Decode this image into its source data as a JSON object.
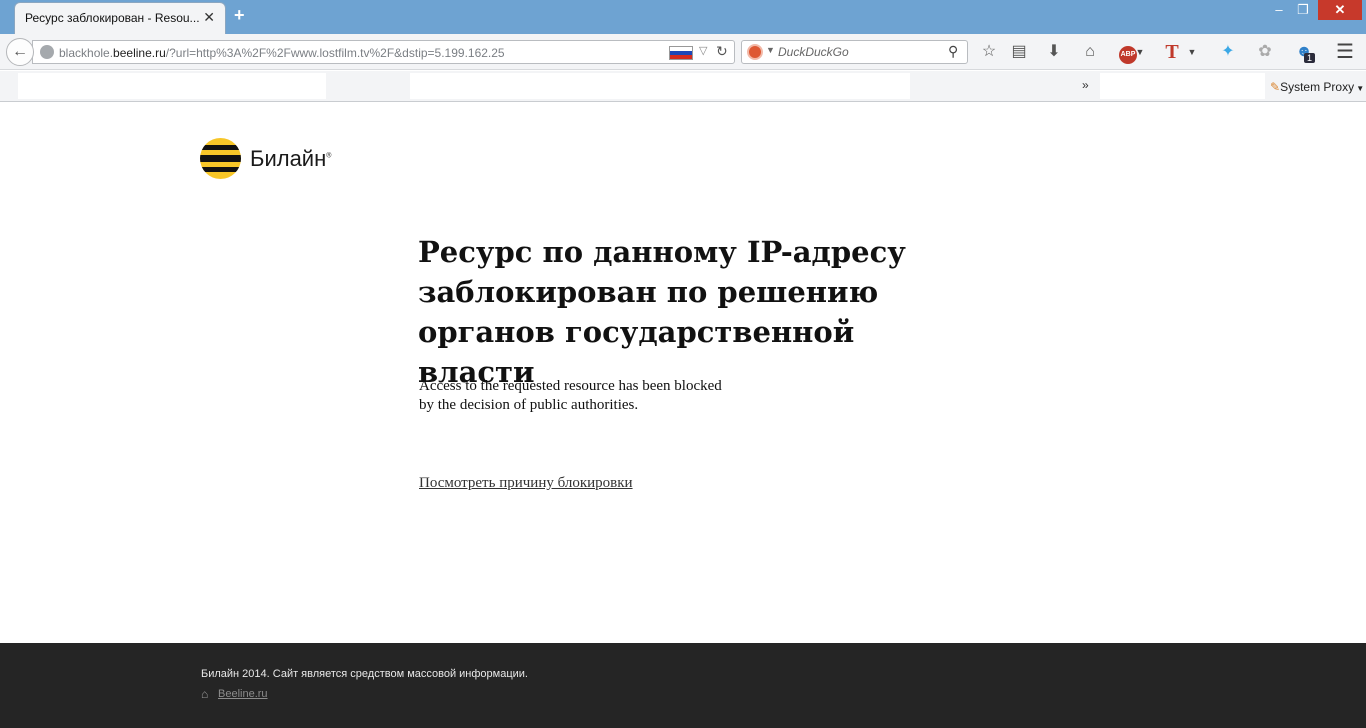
{
  "browser": {
    "tab_title": "Ресурс заблокирован - Resou...",
    "tab_close": "✕",
    "new_tab": "+",
    "window_controls": {
      "minimize": "‒",
      "restore": "❐",
      "close": "✕"
    }
  },
  "navbar": {
    "url_prefix": "blackhole.",
    "url_host": "beeline.ru",
    "url_rest": "/?url=http%3A%2F%2Fwww.lostfilm.tv%2F&dstip=5.199.162.25",
    "search_placeholder": "DuckDuckGo",
    "icons": [
      "back-icon",
      "globe-icon",
      "russia-flag-icon",
      "reload-icon",
      "duckduckgo-icon",
      "search-icon",
      "star-icon",
      "reader-icon",
      "download-icon",
      "home-icon",
      "adblock-icon",
      "t-icon",
      "twitter-icon",
      "paw-icon",
      "ghostery-icon",
      "menu-icon"
    ],
    "ghostery_badge": "1",
    "abp_label": "ABP"
  },
  "bookmarks": {
    "overflow": "»",
    "proxy_label": "System Proxy"
  },
  "page": {
    "logo_text": "Билайн",
    "logo_reg": "®",
    "headline": "Ресурс по данному IP-адресу заблокирован по решению органов государственной власти",
    "subtext_line1": "Access to the requested resource has been blocked",
    "subtext_line2": "by the decision of public authorities.",
    "reason_link": "Посмотреть причину блокировки"
  },
  "footer": {
    "text": "Билайн 2014. Сайт является средством массовой информации.",
    "link": "Beeline.ru"
  },
  "colors": {
    "titlebar": "#6ea3d2",
    "beeline_yellow": "#f7c628",
    "footer_bg": "#252525",
    "close_red": "#c7392b"
  }
}
